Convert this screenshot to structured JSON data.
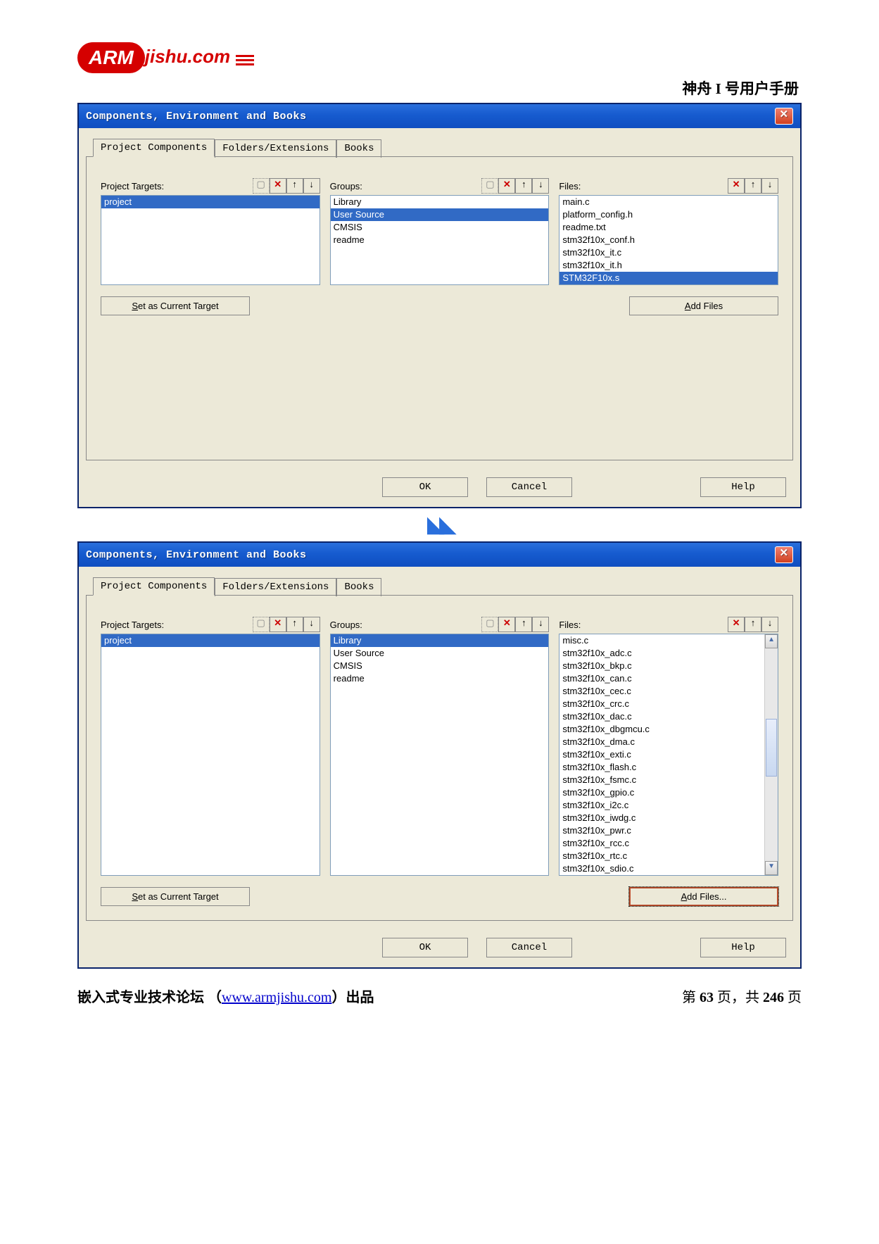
{
  "header": {
    "logo_arm": "ARM",
    "logo_domain": "jishu.com",
    "doc_title": "神舟 I 号用户手册"
  },
  "dialog1": {
    "title": "Components, Environment and Books",
    "tabs": [
      "Project Components",
      "Folders/Extensions",
      "Books"
    ],
    "col1_label": "Project Targets:",
    "col2_label": "Groups:",
    "col3_label": "Files:",
    "targets": [
      "project"
    ],
    "targets_selected": 0,
    "groups": [
      "Library",
      "User Source",
      "CMSIS",
      "readme"
    ],
    "groups_selected": 1,
    "files": [
      "main.c",
      "platform_config.h",
      "readme.txt",
      "stm32f10x_conf.h",
      "stm32f10x_it.c",
      "stm32f10x_it.h",
      "STM32F10x.s"
    ],
    "files_selected": 6,
    "btn_set_target": "Set as Current Target",
    "btn_set_target_u": "S",
    "btn_add_files": "Add Files",
    "btn_add_files_u": "A",
    "ok": "OK",
    "cancel": "Cancel",
    "help": "Help"
  },
  "dialog2": {
    "title": "Components, Environment and Books",
    "tabs": [
      "Project Components",
      "Folders/Extensions",
      "Books"
    ],
    "col1_label": "Project Targets:",
    "col2_label": "Groups:",
    "col3_label": "Files:",
    "targets": [
      "project"
    ],
    "targets_selected": 0,
    "groups": [
      "Library",
      "User Source",
      "CMSIS",
      "readme"
    ],
    "groups_selected": 0,
    "files": [
      "misc.c",
      "stm32f10x_adc.c",
      "stm32f10x_bkp.c",
      "stm32f10x_can.c",
      "stm32f10x_cec.c",
      "stm32f10x_crc.c",
      "stm32f10x_dac.c",
      "stm32f10x_dbgmcu.c",
      "stm32f10x_dma.c",
      "stm32f10x_exti.c",
      "stm32f10x_flash.c",
      "stm32f10x_fsmc.c",
      "stm32f10x_gpio.c",
      "stm32f10x_i2c.c",
      "stm32f10x_iwdg.c",
      "stm32f10x_pwr.c",
      "stm32f10x_rcc.c",
      "stm32f10x_rtc.c",
      "stm32f10x_sdio.c"
    ],
    "files_selected": -1,
    "btn_set_target": "Set as Current Target",
    "btn_set_target_u": "S",
    "btn_add_files": "Add Files...",
    "btn_add_files_u": "A",
    "ok": "OK",
    "cancel": "Cancel",
    "help": "Help"
  },
  "footer": {
    "left_pre": "嵌入式专业技术论坛 （",
    "link": "www.armjishu.com",
    "left_post": "）出品",
    "right_pre": "第 ",
    "page": "63",
    "right_mid": " 页，共 ",
    "total": "246",
    "right_post": " 页"
  }
}
